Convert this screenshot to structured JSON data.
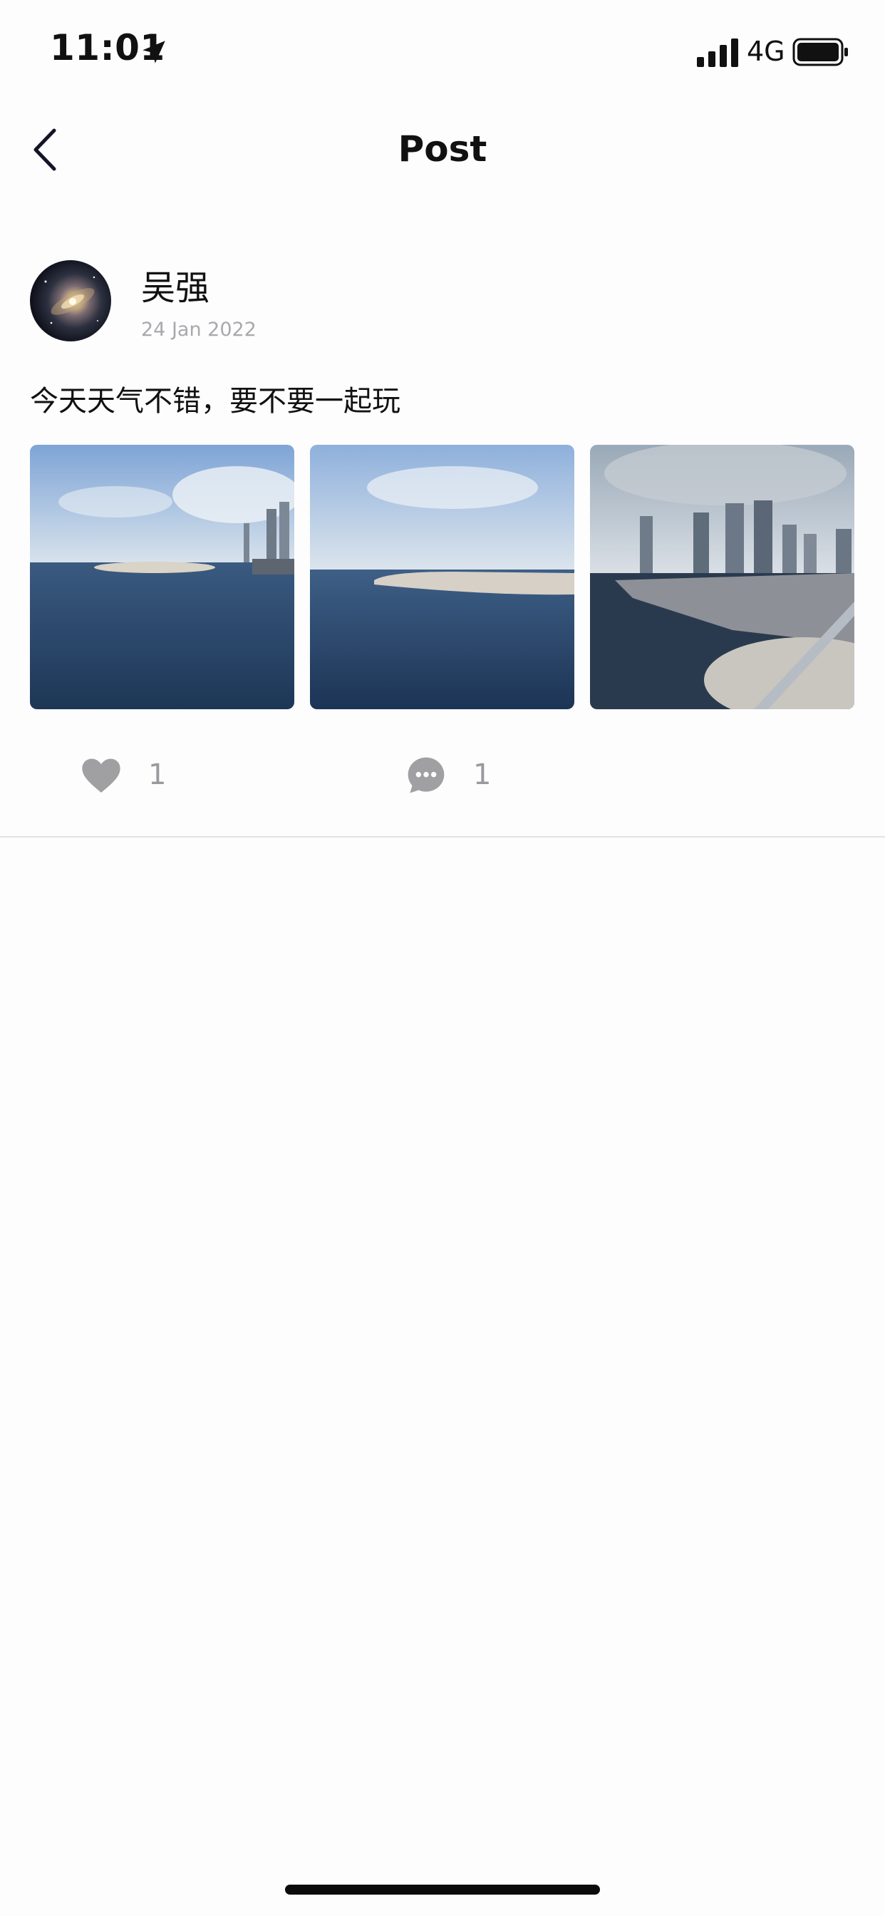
{
  "status_bar": {
    "time": "11:01",
    "network": "4G",
    "icons": [
      "location-arrow-icon",
      "signal-icon",
      "battery-icon"
    ]
  },
  "nav": {
    "title": "Post",
    "back_icon": "chevron-left-icon"
  },
  "post": {
    "author": "吴强",
    "date": "24 Jan 2022",
    "text": "今天天气不错，要不要一起玩",
    "photo_count": 3,
    "likes": "1",
    "comments": "1",
    "like_icon": "heart-icon",
    "comment_icon": "chat-bubble-icon"
  },
  "colors": {
    "background": "#fdfdfd",
    "text": "#111111",
    "muted": "#a9a9ad",
    "action_icon": "#a0a0a3",
    "divider": "#e2e2e4"
  }
}
